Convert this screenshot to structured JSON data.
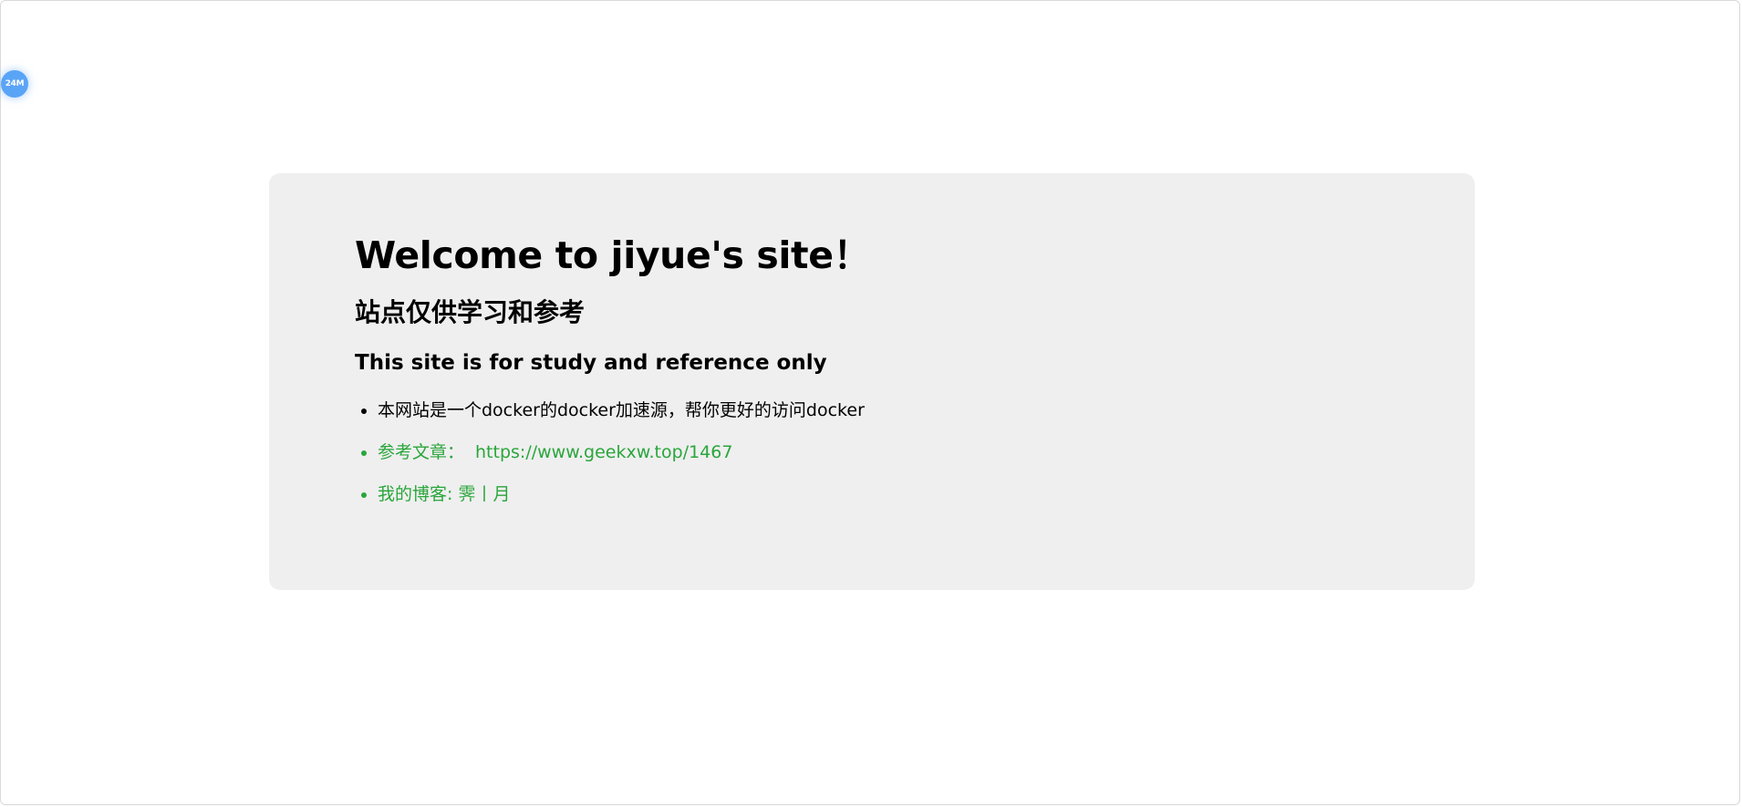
{
  "floating_badge": {
    "label": "24M"
  },
  "card": {
    "title": "Welcome to jiyue's site！",
    "subtitle_cn": "站点仅供学习和参考",
    "subtitle_en": "This site is for study and reference only",
    "items": [
      {
        "text": "本网站是一个docker的docker加速源，帮你更好的访问docker"
      },
      {
        "label": "参考文章：",
        "link_text": "https://www.geekxw.top/1467"
      },
      {
        "link_text": "我的博客: 霁丨月"
      }
    ]
  },
  "colors": {
    "background": "#ffffff",
    "card_background": "#efefef",
    "link": "#2aa63b",
    "badge": "#5aa4f7"
  }
}
